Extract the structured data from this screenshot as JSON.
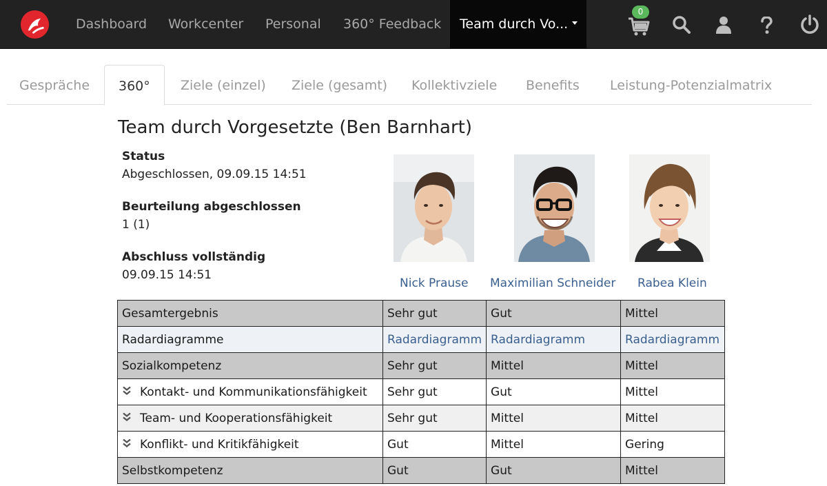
{
  "navbar": {
    "items": [
      "Dashboard",
      "Workcenter",
      "Personal",
      "360° Feedback"
    ],
    "active_item": "Team durch Vo...",
    "cart_count": "0",
    "icons": [
      "cart-icon",
      "search-icon",
      "user-icon",
      "help-icon",
      "power-icon"
    ],
    "accent_color": "#e1262d",
    "badge_color": "#5cb85c"
  },
  "tabs": {
    "items": [
      "Gespräche",
      "360°",
      "Ziele (einzel)",
      "Ziele (gesamt)",
      "Kollektivziele",
      "Benefits",
      "Leistung-Potenzialmatrix"
    ],
    "active": "360°"
  },
  "page": {
    "title": "Team durch Vorgesetzte (Ben Barnhart)",
    "status_label": "Status",
    "status_value": "Abgeschlossen, 09.09.15 14:51",
    "rating_label": "Beurteilung abgeschlossen",
    "rating_value": "1 (1)",
    "completion_label": "Abschluss vollständig",
    "completion_value": "09.09.15 14:51"
  },
  "people": [
    {
      "name": "Nick Prause"
    },
    {
      "name": "Maximilian Schneider"
    },
    {
      "name": "Rabea Klein"
    }
  ],
  "table": {
    "rows": [
      {
        "label": "Gesamtergebnis",
        "values": [
          "Sehr gut",
          "Gut",
          "Mittel"
        ]
      },
      {
        "label": "Radardiagramme",
        "values": [
          "Radardiagramm",
          "Radardiagramm",
          "Radardiagramm"
        ]
      },
      {
        "label": "Sozialkompetenz",
        "values": [
          "Sehr gut",
          "Mittel",
          "Mittel"
        ]
      },
      {
        "label": "Kontakt- und Kommunikationsfähigkeit",
        "values": [
          "Sehr gut",
          "Gut",
          "Mittel"
        ]
      },
      {
        "label": "Team- und Kooperationsfähigkeit",
        "values": [
          "Sehr gut",
          "Mittel",
          "Mittel"
        ]
      },
      {
        "label": "Konflikt- und Kritikfähigkeit",
        "values": [
          "Gut",
          "Mittel",
          "Gering"
        ]
      },
      {
        "label": "Selbstkompetenz",
        "values": [
          "Gut",
          "Gut",
          "Mittel"
        ]
      }
    ]
  }
}
